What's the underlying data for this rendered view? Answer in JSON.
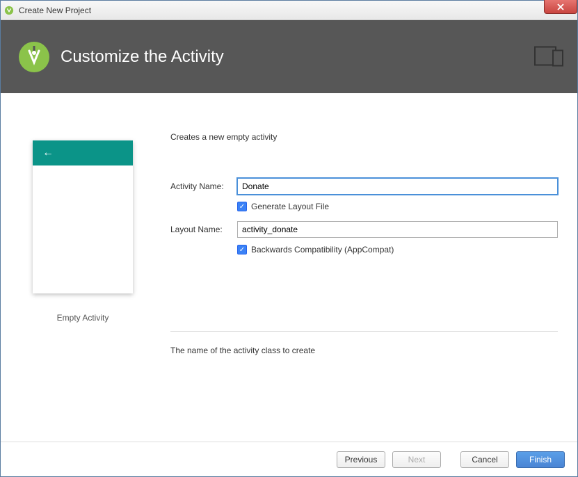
{
  "window": {
    "title": "Create New Project"
  },
  "banner": {
    "title": "Customize the Activity"
  },
  "form": {
    "description": "Creates a new empty activity",
    "activity_name_label": "Activity Name:",
    "activity_name_value": "Donate",
    "generate_layout_label": "Generate Layout File",
    "generate_layout_checked": true,
    "layout_name_label": "Layout Name:",
    "layout_name_value": "activity_donate",
    "backwards_compat_label": "Backwards Compatibility (AppCompat)",
    "backwards_compat_checked": true,
    "hint": "The name of the activity class to create"
  },
  "preview": {
    "label": "Empty Activity"
  },
  "buttons": {
    "previous": "Previous",
    "next": "Next",
    "cancel": "Cancel",
    "finish": "Finish"
  }
}
